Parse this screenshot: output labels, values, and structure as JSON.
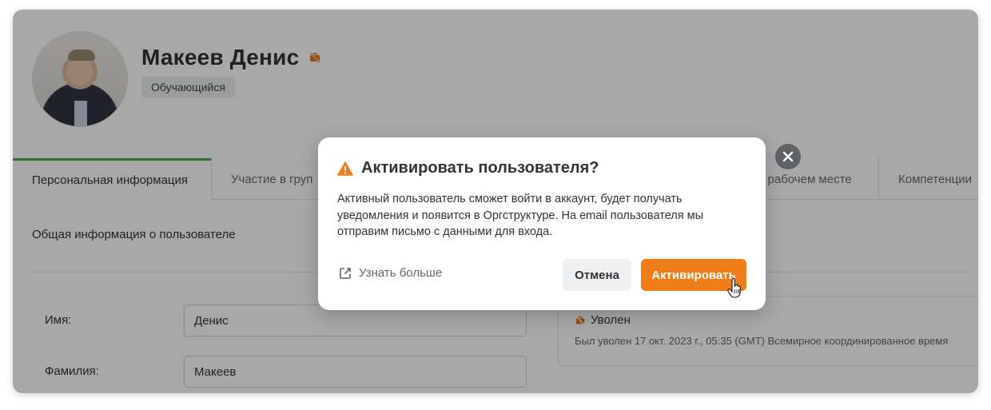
{
  "profile": {
    "name": "Макеев Денис",
    "role_badge": "Обучающийся",
    "status_icon": "fired-briefcase-icon"
  },
  "tabs": [
    {
      "label": "Персональная информация",
      "active": true
    },
    {
      "label": "Участие в груп",
      "active": false
    },
    {
      "label": "а рабочем месте",
      "active": false
    },
    {
      "label": "Компетенции",
      "active": false
    }
  ],
  "section": {
    "title": "Общая информация о пользователе"
  },
  "fields": [
    {
      "label": "Имя:",
      "value": "Денис"
    },
    {
      "label": "Фамилия:",
      "value": "Макеев"
    }
  ],
  "employment_status": {
    "label": "Уволен",
    "note": "Был уволен 17 окт. 2023 г., 05:35 (GMT) Всемирное координированное время"
  },
  "modal": {
    "title": "Активировать пользователя?",
    "body": "Активный пользователь сможет войти в аккаунт, будет получать уведомления и появится в Оргструктуре. На email пользователя мы отправим письмо с данными для входа.",
    "learn_more_label": "Узнать больше",
    "cancel_label": "Отмена",
    "activate_label": "Активировать",
    "warning_icon": "warning-icon",
    "close_icon": "close-icon"
  },
  "colors": {
    "accent_orange": "#f07d1a",
    "active_tab_green": "#4caf50",
    "overlay": "rgba(0,0,0,0.34)"
  }
}
